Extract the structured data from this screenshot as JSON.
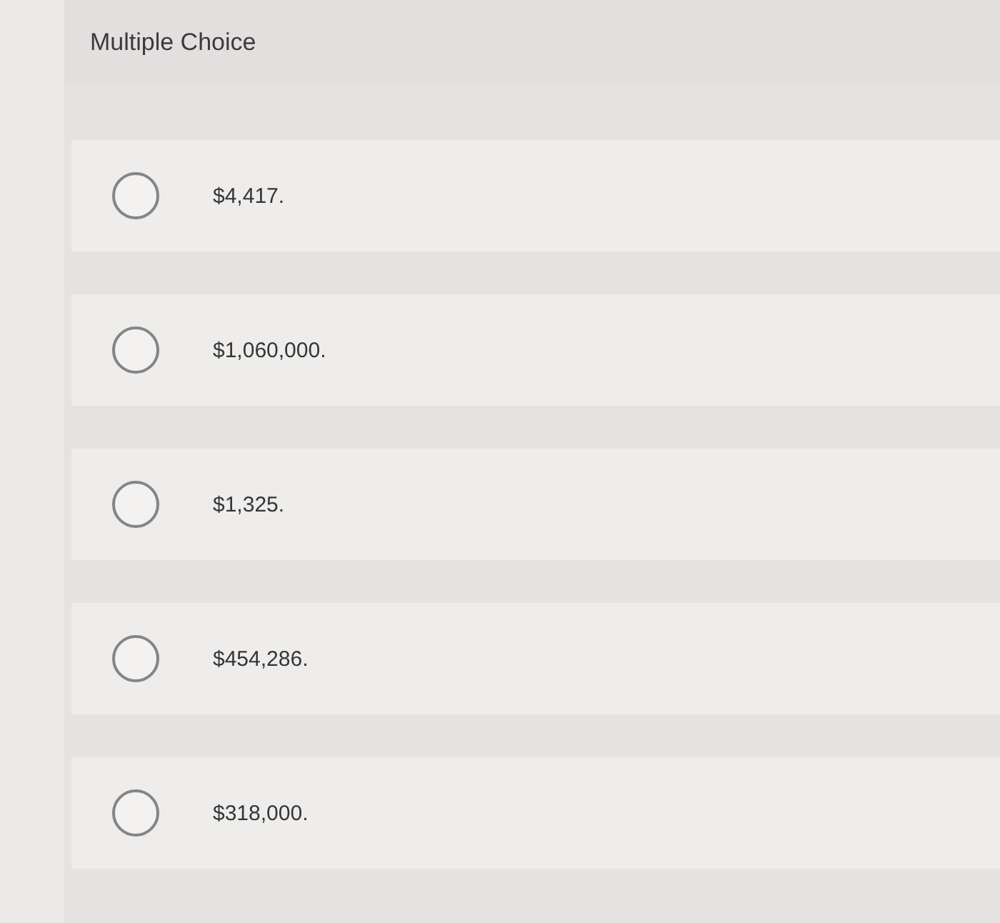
{
  "title": "Multiple Choice",
  "options": [
    {
      "label": "$4,417.",
      "selected": false
    },
    {
      "label": "$1,060,000.",
      "selected": false
    },
    {
      "label": "$1,325.",
      "selected": false
    },
    {
      "label": "$454,286.",
      "selected": false
    },
    {
      "label": "$318,000.",
      "selected": false
    }
  ]
}
